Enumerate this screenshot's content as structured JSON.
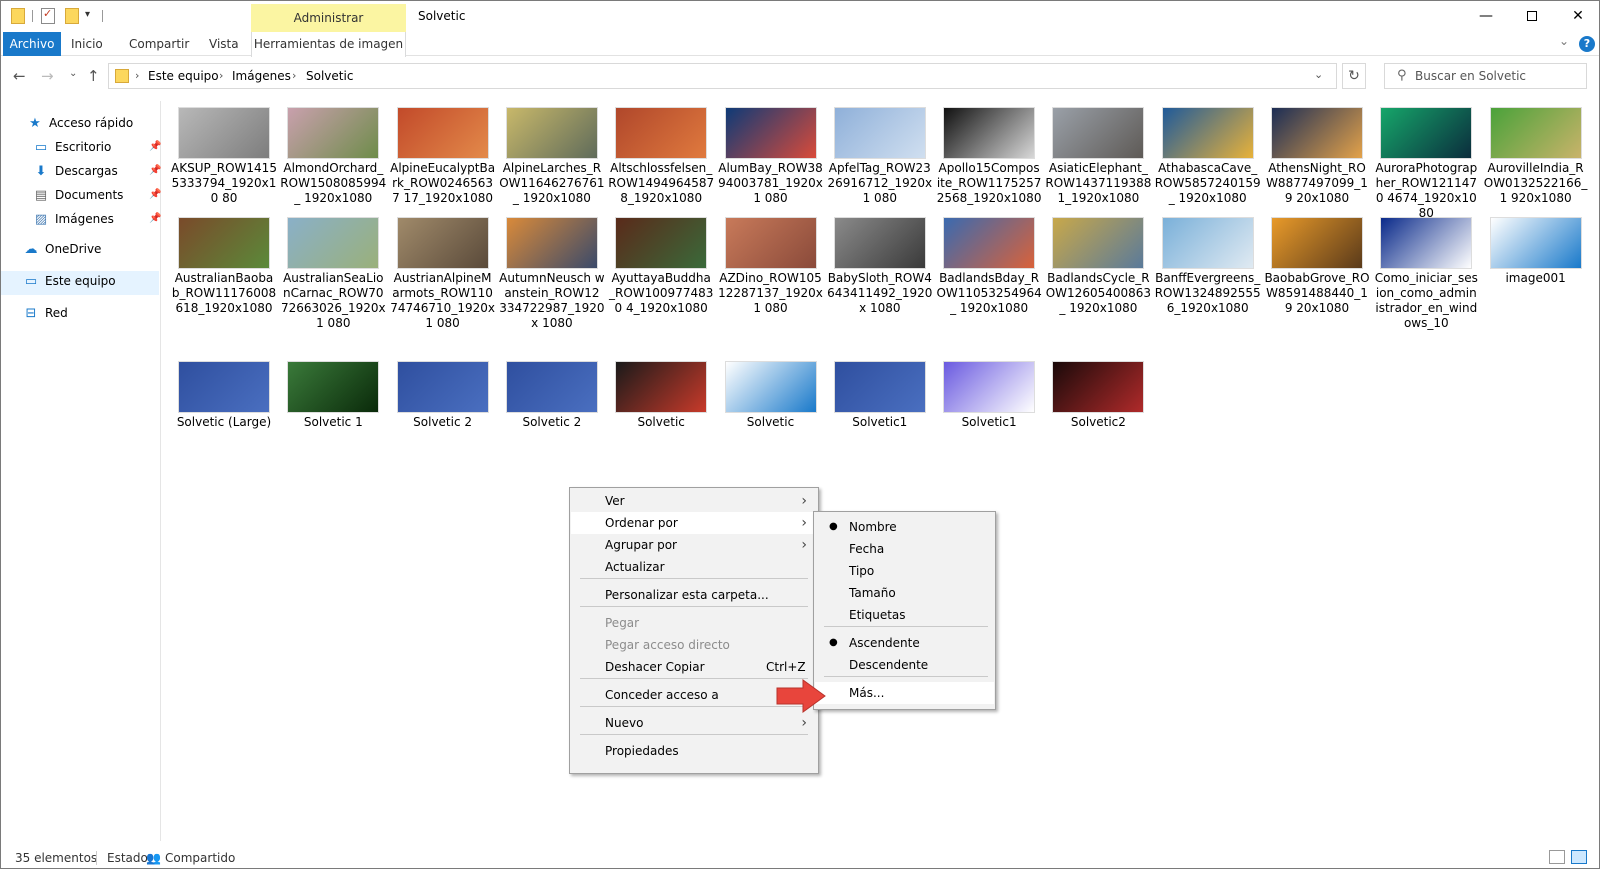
{
  "window": {
    "title": "Solvetic",
    "contextual_tab_header": "Administrar",
    "controls": {
      "minimize": "—",
      "close": "✕"
    }
  },
  "quick_access_toolbar": {
    "dropdown": "▾"
  },
  "ribbon": {
    "tabs": [
      "Archivo",
      "Inicio",
      "Compartir",
      "Vista",
      "Herramientas de imagen"
    ],
    "expand": "⌄",
    "help": "?"
  },
  "address": {
    "back": "←",
    "forward": "→",
    "recent": "⌄",
    "up": "↑",
    "breadcrumb": [
      "Este equipo",
      "Imágenes",
      "Solvetic"
    ],
    "separator": "›",
    "chevron": "⌄",
    "refresh": "↻"
  },
  "search": {
    "placeholder": "Buscar en Solvetic",
    "icon": "⚲"
  },
  "sidebar": {
    "items": [
      {
        "label": "Acceso rápido",
        "icon": "star-icon",
        "glyph": "★",
        "color": "#1979ca"
      },
      {
        "label": "Escritorio",
        "icon": "desktop-icon",
        "glyph": "▭",
        "color": "#1979ca",
        "pinned": true
      },
      {
        "label": "Descargas",
        "icon": "download-icon",
        "glyph": "⬇",
        "color": "#1979ca",
        "pinned": true
      },
      {
        "label": "Documents",
        "icon": "document-icon",
        "glyph": "▤",
        "color": "#666666",
        "pinned": true
      },
      {
        "label": "Imágenes",
        "icon": "images-icon",
        "glyph": "▨",
        "color": "#4a7fb5",
        "pinned": true
      },
      {
        "label": "OneDrive",
        "icon": "cloud-icon",
        "glyph": "☁",
        "color": "#1979ca"
      },
      {
        "label": "Este equipo",
        "icon": "computer-icon",
        "glyph": "▭",
        "color": "#1979ca"
      },
      {
        "label": "Red",
        "icon": "network-icon",
        "glyph": "⊟",
        "color": "#1979ca"
      }
    ],
    "pin_glyph": "📌"
  },
  "files": [
    {
      "name": "AKSUP_ROW1415 5333794_1920x10 80",
      "colors": [
        "#b8b8b8",
        "#7d7d7d"
      ]
    },
    {
      "name": "AlmondOrchard_ ROW1508085994_ 1920x1080",
      "colors": [
        "#c9a0ad",
        "#6e8c4a"
      ]
    },
    {
      "name": "AlpineEucalyptBa rk_ROW02465637 17_1920x1080",
      "colors": [
        "#c24a2a",
        "#e38a4a"
      ]
    },
    {
      "name": "AlpineLarches_R OW11646276761_ 1920x1080",
      "colors": [
        "#c8b86a",
        "#5f6b5a"
      ]
    },
    {
      "name": "Altschlossfelsen_ ROW1494964587 8_1920x1080",
      "colors": [
        "#b0472b",
        "#e07a3e"
      ]
    },
    {
      "name": "AlumBay_ROW38 94003781_1920x1 080",
      "colors": [
        "#0e3a77",
        "#d94b3a"
      ]
    },
    {
      "name": "ApfelTag_ROW23 26916712_1920x1 080",
      "colors": [
        "#8fb0d9",
        "#d0dff0"
      ]
    },
    {
      "name": "Apollo15Compos ite_ROW1175257 2568_1920x1080",
      "colors": [
        "#111111",
        "#d8d8d8"
      ]
    },
    {
      "name": "AsiaticElephant_ ROW1437119388 1_1920x1080",
      "colors": [
        "#9aa0a8",
        "#5e5a56"
      ]
    },
    {
      "name": "AthabascaCave_ ROW5857240159_ 1920x1080",
      "colors": [
        "#1f5a9a",
        "#e8b23a"
      ]
    },
    {
      "name": "AthensNight_RO W8877497099_19 20x1080",
      "colors": [
        "#1c2d55",
        "#e3a24a"
      ]
    },
    {
      "name": "AuroraPhotograp her_ROW1211470 4674_1920x1080",
      "colors": [
        "#16a66a",
        "#0b2d3d"
      ]
    },
    {
      "name": "AurovilleIndia_R OW0132522166_1 920x1080",
      "colors": [
        "#4aa23a",
        "#c9b36a"
      ]
    },
    {
      "name": "AustralianBaoba b_ROW11176008 618_1920x1080",
      "colors": [
        "#7a4a2a",
        "#5b8a3a"
      ]
    },
    {
      "name": "AustralianSeaLio nCarnac_ROW70 72663026_1920x1 080",
      "colors": [
        "#8ab0c8",
        "#9ab07a"
      ]
    },
    {
      "name": "AustrianAlpineM armots_ROW110 74746710_1920x1 080",
      "colors": [
        "#a08a6a",
        "#5a4a3a"
      ]
    },
    {
      "name": "AutumnNeusch wanstein_ROW12 334722987_1920x 1080",
      "colors": [
        "#d98a3a",
        "#3a4a6a"
      ]
    },
    {
      "name": "AyuttayaBuddha _ROW1009774830 4_1920x1080",
      "colors": [
        "#5a2a1a",
        "#3a6a3a"
      ]
    },
    {
      "name": "AZDino_ROW105 12287137_1920x1 080",
      "colors": [
        "#c87a5a",
        "#8a4a3a"
      ]
    },
    {
      "name": "BabySloth_ROW4 643411492_1920x 1080",
      "colors": [
        "#8a8a8a",
        "#3a3a3a"
      ]
    },
    {
      "name": "BadlandsBday_R OW11053254964_ 1920x1080",
      "colors": [
        "#3a6ab0",
        "#d9623a"
      ]
    },
    {
      "name": "BadlandsCycle_R OW12605400863_ 1920x1080",
      "colors": [
        "#c8a84a",
        "#5a7a9a"
      ]
    },
    {
      "name": "BanffEvergreens_ ROW1324892555 6_1920x1080",
      "colors": [
        "#7ab0d9",
        "#e0eaf2"
      ]
    },
    {
      "name": "BaobabGrove_RO W8591488440_19 20x1080",
      "colors": [
        "#e89a2a",
        "#5a3a1a"
      ]
    },
    {
      "name": "Como_iniciar_ses ion_como_admin istrador_en_wind ows_10",
      "colors": [
        "#0a2a8a",
        "#ffffff"
      ]
    },
    {
      "name": "image001",
      "colors": [
        "#ffffff",
        "#1979ca"
      ]
    },
    {
      "name": "Solvetic (Large)",
      "colors": [
        "#2f4f9f",
        "#4a6fc0"
      ]
    },
    {
      "name": "Solvetic 1",
      "colors": [
        "#3a7a3a",
        "#0a2a0a"
      ]
    },
    {
      "name": "Solvetic 2",
      "colors": [
        "#2f4f9f",
        "#4a6fc0"
      ]
    },
    {
      "name": "Solvetic 2",
      "colors": [
        "#2f4f9f",
        "#4a6fc0"
      ]
    },
    {
      "name": "Solvetic",
      "colors": [
        "#1a1a1a",
        "#c83a2a"
      ]
    },
    {
      "name": "Solvetic",
      "colors": [
        "#ffffff",
        "#1979ca"
      ]
    },
    {
      "name": "Solvetic1",
      "colors": [
        "#2f4f9f",
        "#4a6fc0"
      ]
    },
    {
      "name": "Solvetic1",
      "colors": [
        "#6a5ae0",
        "#ffffff"
      ]
    },
    {
      "name": "Solvetic2",
      "colors": [
        "#1a0a0a",
        "#b02a2a"
      ]
    }
  ],
  "context_menu": {
    "items": [
      {
        "label": "Ver",
        "submenu": true
      },
      {
        "label": "Ordenar por",
        "submenu": true,
        "highlighted": true
      },
      {
        "label": "Agrupar por",
        "submenu": true
      },
      {
        "label": "Actualizar"
      },
      {
        "label": "Personalizar esta carpeta..."
      },
      {
        "label": "Pegar",
        "disabled": true
      },
      {
        "label": "Pegar acceso directo",
        "disabled": true
      },
      {
        "label": "Deshacer Copiar",
        "shortcut": "Ctrl+Z"
      },
      {
        "label": "Conceder acceso a",
        "submenu": true
      },
      {
        "label": "Nuevo",
        "submenu": true
      },
      {
        "label": "Propiedades"
      }
    ],
    "arrow_glyph": "›"
  },
  "sort_submenu": {
    "items": [
      {
        "label": "Nombre",
        "checked": true
      },
      {
        "label": "Fecha"
      },
      {
        "label": "Tipo"
      },
      {
        "label": "Tamaño"
      },
      {
        "label": "Etiquetas"
      },
      {
        "label": "Ascendente",
        "checked": true
      },
      {
        "label": "Descendente"
      },
      {
        "label": "Más...",
        "highlighted": true
      }
    ],
    "dot_glyph": "●"
  },
  "status": {
    "count": "35 elementos",
    "state_label": "Estado:",
    "state_icon": "👥",
    "state_value": "Compartido"
  },
  "colors": {
    "accent": "#1979ca",
    "contextual_tab": "#fbf5a2",
    "selected_nav": "#e5f3ff",
    "pointer_arrow": "#e8453c"
  }
}
